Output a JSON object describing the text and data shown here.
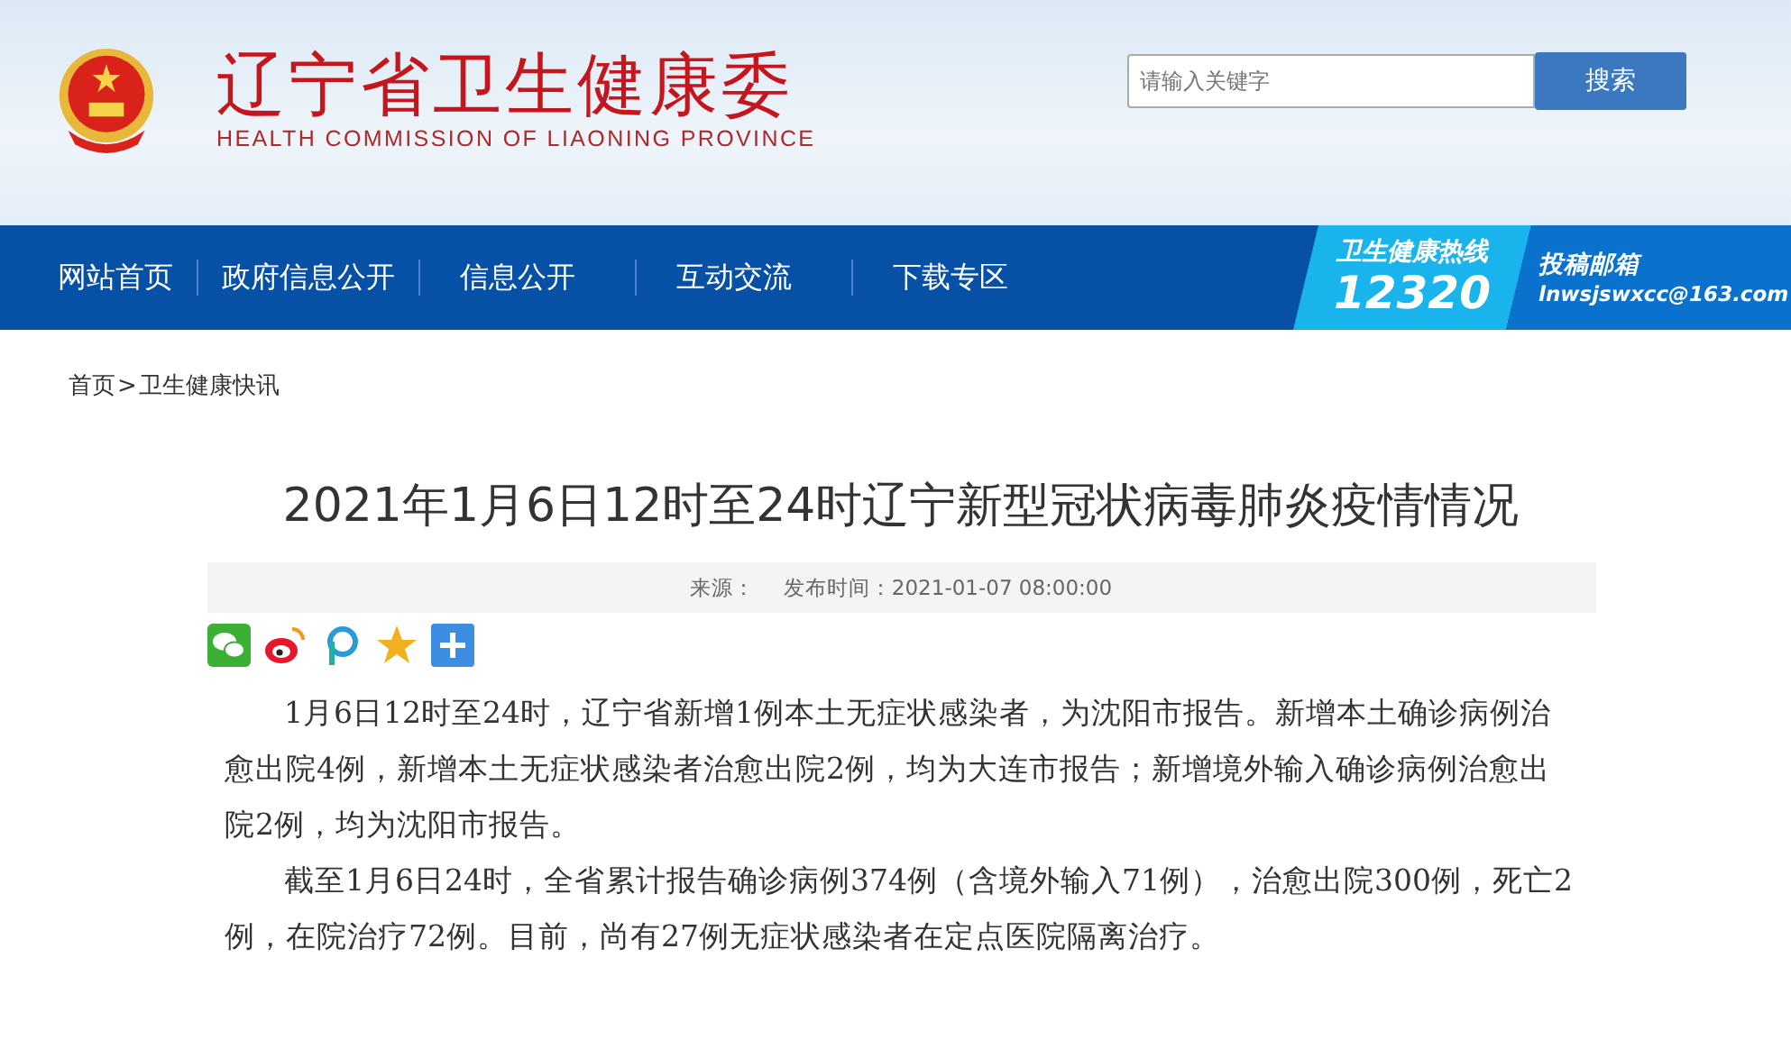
{
  "header": {
    "title": "辽宁省卫生健康委",
    "subtitle": "HEALTH COMMISSION OF LIAONING PROVINCE"
  },
  "search": {
    "placeholder": "请输入关键字",
    "button": "搜索"
  },
  "nav": {
    "items": [
      {
        "label": "网站首页"
      },
      {
        "label": "政府信息公开"
      },
      {
        "label": "信息公开"
      },
      {
        "label": "互动交流"
      },
      {
        "label": "下载专区"
      }
    ],
    "hotline": {
      "label": "卫生健康热线",
      "number": "12320"
    },
    "mailbox": {
      "label": "投稿邮箱",
      "email": "lnwsjswxcc@163.com"
    }
  },
  "breadcrumb": [
    {
      "label": "首页"
    },
    {
      "label": "卫生健康快讯"
    }
  ],
  "breadcrumb_separator": ">",
  "article": {
    "title": "2021年1月6日12时至24时辽宁新型冠状病毒肺炎疫情情况",
    "source_label": "来源：",
    "date": "发布时间：2021-01-07 08:00:00",
    "share": [
      {
        "kind": "wechat"
      },
      {
        "kind": "weibo"
      },
      {
        "kind": "p"
      },
      {
        "kind": "qzone"
      },
      {
        "kind": "more"
      }
    ],
    "paragraphs": [
      "1月6日12时至24时，辽宁省新增1例本土无症状感染者，为沈阳市报告。新增本土确诊病例治愈出院4例，新增本土无症状感染者治愈出院2例，均为大连市报告；新增境外输入确诊病例治愈出院2例，均为沈阳市报告。",
      "截至1月6日24时，全省累计报告确诊病例374例（含境外输入71例），治愈出院300例，死亡2例，在院治疗72例。目前，尚有27例无症状感染者在定点医院隔离治疗。"
    ]
  }
}
